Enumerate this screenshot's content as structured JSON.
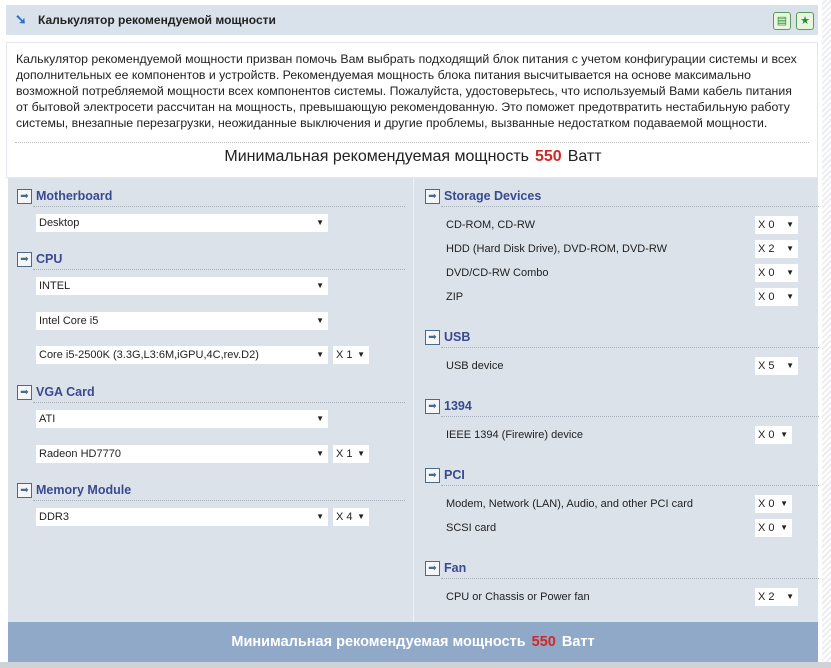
{
  "header": {
    "title": "Калькулятор рекомендуемой мощности",
    "icons": [
      "arrow-down-right-icon",
      "print-icon",
      "bookmark-star-icon"
    ]
  },
  "description": "Калькулятор рекомендуемой мощности призван помочь Вам выбрать подходящий блок питания с учетом конфигурации системы и всех дополнительных ее компонентов и устройств. Рекомендуемая мощность блока питания высчитывается на основе максимально возможной потребляемой мощности всех компонентов системы. Пожалуйста, удостоверьтесь, что используемый Вами кабель питания от бытовой электросети рассчитан на мощность, превышающую рекомендованную. Это поможет предотвратить нестабильную работу системы, внезапные перезагрузки, неожиданные выключения и другие проблемы, вызванные недостатком подаваемой мощности.",
  "result": {
    "label": "Минимальная рекомендуемая мощность",
    "value": "550",
    "unit": "Ватт",
    "value_color": "#d02828"
  },
  "left": {
    "motherboard": {
      "title": "Motherboard",
      "type": "Desktop"
    },
    "cpu": {
      "title": "CPU",
      "vendor": "INTEL",
      "family": "Intel Core i5",
      "model": "Core i5-2500K (3.3G,L3:6M,iGPU,4C,rev.D2)",
      "qty": "X 1"
    },
    "vga": {
      "title": "VGA Card",
      "vendor": "ATI",
      "model": "Radeon HD7770",
      "qty": "X 1"
    },
    "memory": {
      "title": "Memory Module",
      "type": "DDR3",
      "qty": "X 4"
    }
  },
  "right": {
    "storage": {
      "title": "Storage Devices",
      "items": [
        {
          "label": "CD-ROM, CD-RW",
          "qty": "X 0"
        },
        {
          "label": "HDD (Hard Disk Drive), DVD-ROM, DVD-RW",
          "qty": "X 2"
        },
        {
          "label": "DVD/CD-RW Combo",
          "qty": "X 0"
        },
        {
          "label": "ZIP",
          "qty": "X 0"
        }
      ]
    },
    "usb": {
      "title": "USB",
      "items": [
        {
          "label": "USB device",
          "qty": "X 5"
        }
      ]
    },
    "ieee1394": {
      "title": "1394",
      "items": [
        {
          "label": "IEEE 1394 (Firewire) device",
          "qty": "X 0"
        }
      ]
    },
    "pci": {
      "title": "PCI",
      "items": [
        {
          "label": "Modem, Network (LAN), Audio, and other PCI card",
          "qty": "X 0"
        },
        {
          "label": "SCSI card",
          "qty": "X 0"
        }
      ]
    },
    "fan": {
      "title": "Fan",
      "items": [
        {
          "label": "CPU or Chassis or Power fan",
          "qty": "X 2"
        }
      ]
    }
  }
}
